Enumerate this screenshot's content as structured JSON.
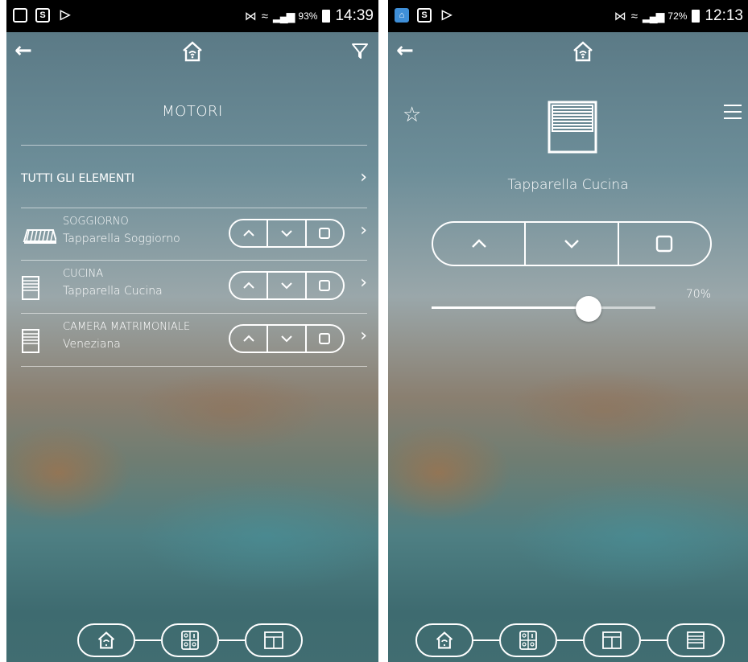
{
  "left_screen": {
    "status_bar": {
      "battery_pct": "93%",
      "time": "14:39"
    },
    "title": "MOTORI",
    "all_elements_label": "TUTTI GLI ELEMENTI",
    "devices": [
      {
        "name": "SOGGIORNO",
        "desc": "Tapparella Soggiorno",
        "icon": "awning-icon"
      },
      {
        "name": "CUCINA",
        "desc": "Tapparella Cucina",
        "icon": "shutter-icon"
      },
      {
        "name": "CAMERA MATRIMONIALE",
        "desc": "Veneziana",
        "icon": "shutter-icon"
      }
    ],
    "bottom_nav": [
      "home-icon",
      "climate-icon",
      "window-icon"
    ]
  },
  "right_screen": {
    "status_bar": {
      "battery_pct": "72%",
      "time": "12:13"
    },
    "device_title": "Tapparella Cucina",
    "position_pct": 70,
    "position_label": "70%",
    "bottom_nav": [
      "home-icon",
      "climate-icon",
      "window-icon",
      "shutter-icon"
    ]
  }
}
